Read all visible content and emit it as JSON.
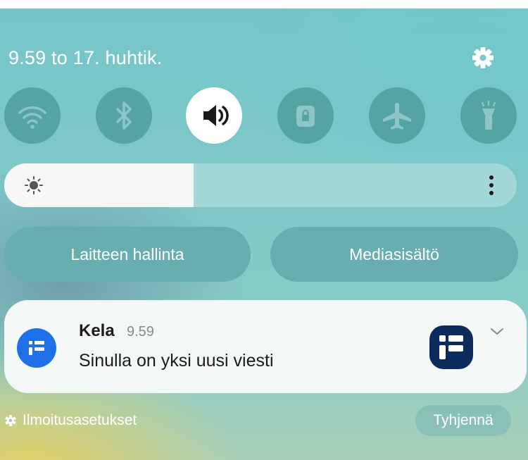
{
  "status": {
    "datetime": "9.59  to 17. huhtik."
  },
  "icons": {
    "settings": "gear-icon",
    "wifi": "wifi-icon",
    "bluetooth": "bluetooth-icon",
    "sound": "speaker-icon",
    "secure_folder": "lock-folder-icon",
    "airplane": "airplane-icon",
    "flashlight": "flashlight-icon",
    "brightness": "sun-icon",
    "more": "more-vertical-icon",
    "app": "kela-app-icon",
    "expand": "chevron-down-icon"
  },
  "quick_settings": [
    {
      "name": "wifi",
      "active": false
    },
    {
      "name": "bluetooth",
      "active": false
    },
    {
      "name": "sound",
      "active": true
    },
    {
      "name": "secure-folder",
      "active": false
    },
    {
      "name": "airplane-mode",
      "active": false
    },
    {
      "name": "flashlight",
      "active": false
    }
  ],
  "brightness": {
    "level": 0.37
  },
  "buttons": {
    "device_control": "Laitteen hallinta",
    "media_output": "Mediasisältö"
  },
  "notification": {
    "app": "Kela",
    "time": "9.59",
    "message": "Sinulla on yksi uusi viesti"
  },
  "footer": {
    "notification_settings": "Ilmoitusasetukset",
    "clear": "Tyhjennä"
  },
  "colors": {
    "panel_bg": "#7ec8c8",
    "tile_off": "#56a3a3",
    "tile_on": "#ffffff",
    "kela_blue": "#1f6fe8",
    "kela_navy": "#0d2a5c"
  }
}
